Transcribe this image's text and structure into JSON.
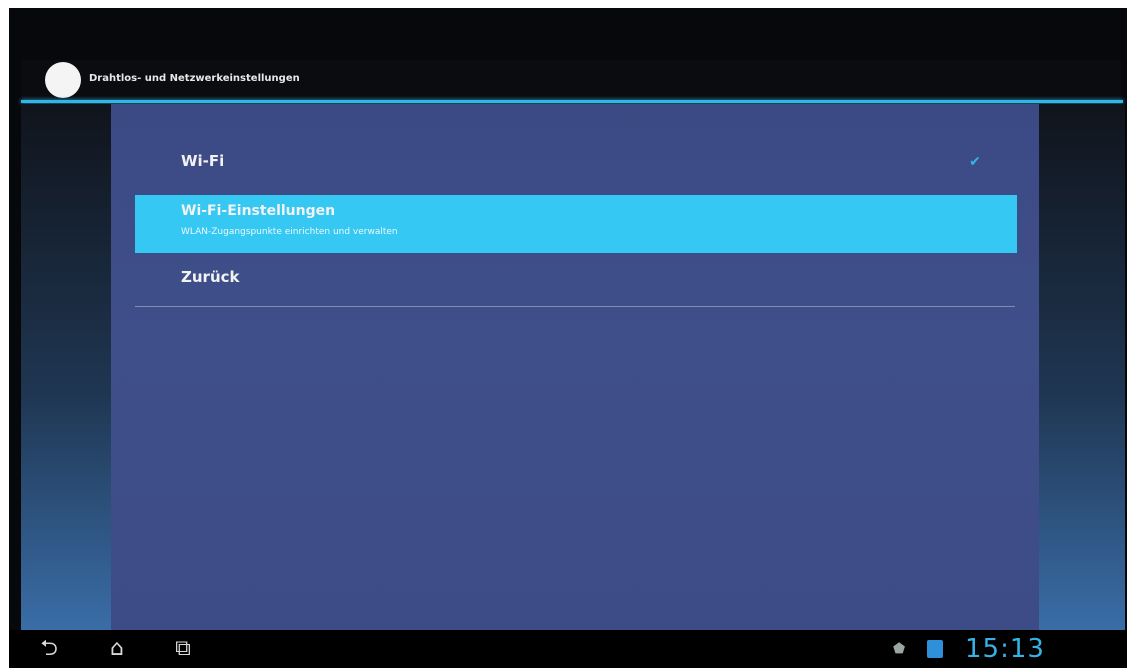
{
  "action_bar": {
    "title": "Drahtlos- und Netzwerkeinstellungen",
    "app_icon": "settings-app-icon"
  },
  "settings": {
    "items": [
      {
        "title": "Wi-Fi",
        "checked": true
      },
      {
        "title": "Wi-Fi-Einstellungen",
        "summary": "WLAN-Zugangspunkte einrichten und verwalten",
        "selected": true
      },
      {
        "title": "Zurück"
      }
    ]
  },
  "system_bar": {
    "clock": "15:13",
    "icons": [
      "back-icon",
      "home-icon",
      "recent-apps-icon",
      "shopping-bag-icon",
      "notification-icon"
    ]
  },
  "colors": {
    "accent": "#35c8f2",
    "panel": "#3e4c87",
    "clock": "#35b3e6"
  }
}
